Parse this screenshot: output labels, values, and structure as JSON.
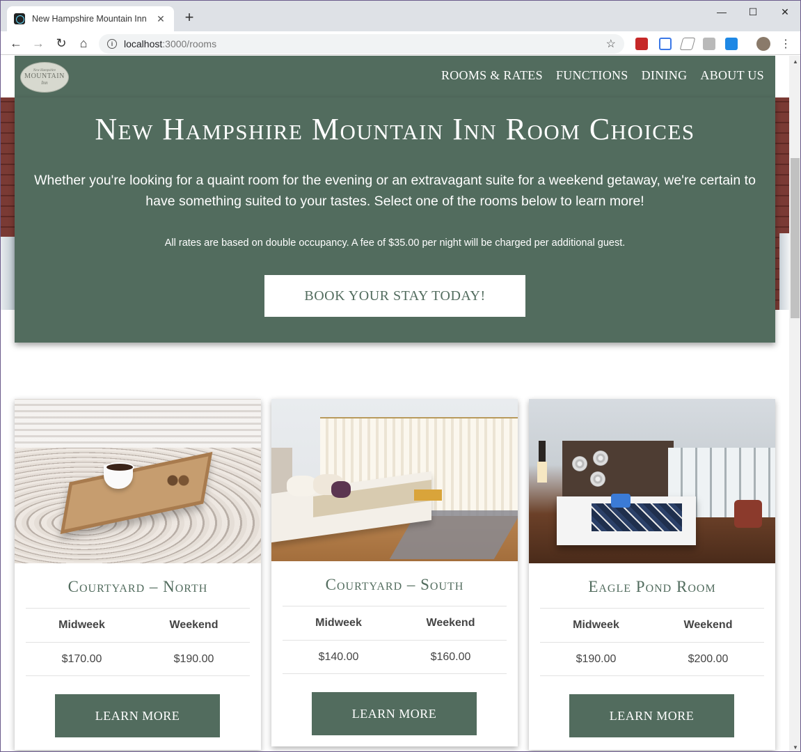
{
  "browser": {
    "tab_title": "New Hampshire Mountain Inn",
    "url_host": "localhost",
    "url_path": ":3000/rooms"
  },
  "logo": {
    "line1": "New Hampshire",
    "line2": "MOUNTAIN",
    "line3": "Inn"
  },
  "nav": {
    "items": [
      "ROOMS & RATES",
      "FUNCTIONS",
      "DINING",
      "ABOUT US"
    ]
  },
  "hero": {
    "title": "New Hampshire Mountain Inn Room Choices",
    "lead": "Whether you're looking for a quaint room for the evening or an extravagant suite for a weekend getaway, we're certain to have something suited to your tastes. Select one of the rooms below to learn more!",
    "note": "All rates are based on double occupancy. A fee of $35.00 per night will be charged per additional guest.",
    "cta": "BOOK YOUR STAY TODAY!"
  },
  "rooms": [
    {
      "name": "Courtyard – North",
      "midweek_label": "Midweek",
      "weekend_label": "Weekend",
      "midweek": "$170.00",
      "weekend": "$190.00",
      "button": "LEARN MORE"
    },
    {
      "name": "Courtyard – South",
      "midweek_label": "Midweek",
      "weekend_label": "Weekend",
      "midweek": "$140.00",
      "weekend": "$160.00",
      "button": "LEARN MORE"
    },
    {
      "name": "Eagle Pond Room",
      "midweek_label": "Midweek",
      "weekend_label": "Weekend",
      "midweek": "$190.00",
      "weekend": "$200.00",
      "button": "LEARN MORE"
    }
  ],
  "colors": {
    "brand_green": "#526c5e",
    "hero_text": "#ffffff"
  }
}
